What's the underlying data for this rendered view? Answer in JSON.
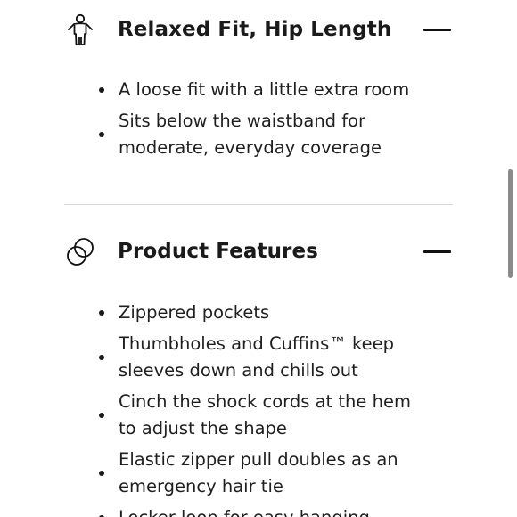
{
  "sections": [
    {
      "title": "Relaxed Fit, Hip Length",
      "icon": "person-fit-icon",
      "toggle": "collapse-minus-icon",
      "bullets": [
        "A loose fit with a little extra room",
        "Sits below the waistband for moderate, everyday coverage"
      ]
    },
    {
      "title": "Product Features",
      "icon": "overlapping-circles-icon",
      "toggle": "collapse-minus-icon",
      "bullets": [
        "Zippered pockets",
        "Thumbholes and Cuffins™ keep sleeves down and chills out",
        "Cinch the shock cords at the hem to adjust the shape",
        "Elastic zipper pull doubles as an emergency hair tie",
        "Locker loop for easy hanging"
      ]
    }
  ]
}
